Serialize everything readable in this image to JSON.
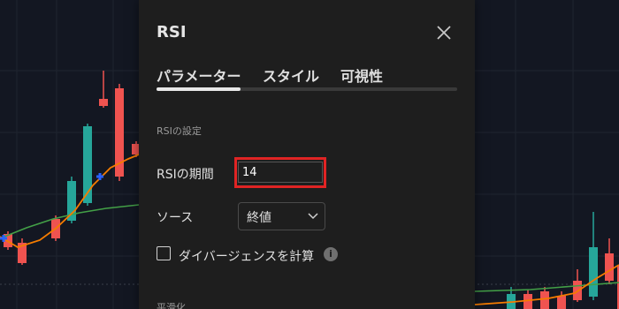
{
  "dialog": {
    "title": "RSI",
    "tabs": [
      {
        "label": "パラメーター",
        "active": true
      },
      {
        "label": "スタイル",
        "active": false
      },
      {
        "label": "可視性",
        "active": false
      }
    ],
    "section_title": "RSIの設定",
    "period": {
      "label": "RSIの期間",
      "value": "14"
    },
    "source": {
      "label": "ソース",
      "selected": "終値"
    },
    "divergence": {
      "label": "ダイバージェンスを計算",
      "checked": false
    },
    "info_glyph": "i",
    "next_section": "平滑化"
  },
  "colors": {
    "background": "#131722",
    "dialog": "#1e1e1e",
    "up_candle": "#26a69a",
    "down_candle": "#ef5350",
    "rsi_line": "#f57c00",
    "ma_line": "#43a047",
    "signal": "#2962ff",
    "highlight": "#e02424"
  },
  "icons": [
    "close-icon",
    "chevron-down-icon",
    "info-icon",
    "cross-marker-icon"
  ]
}
